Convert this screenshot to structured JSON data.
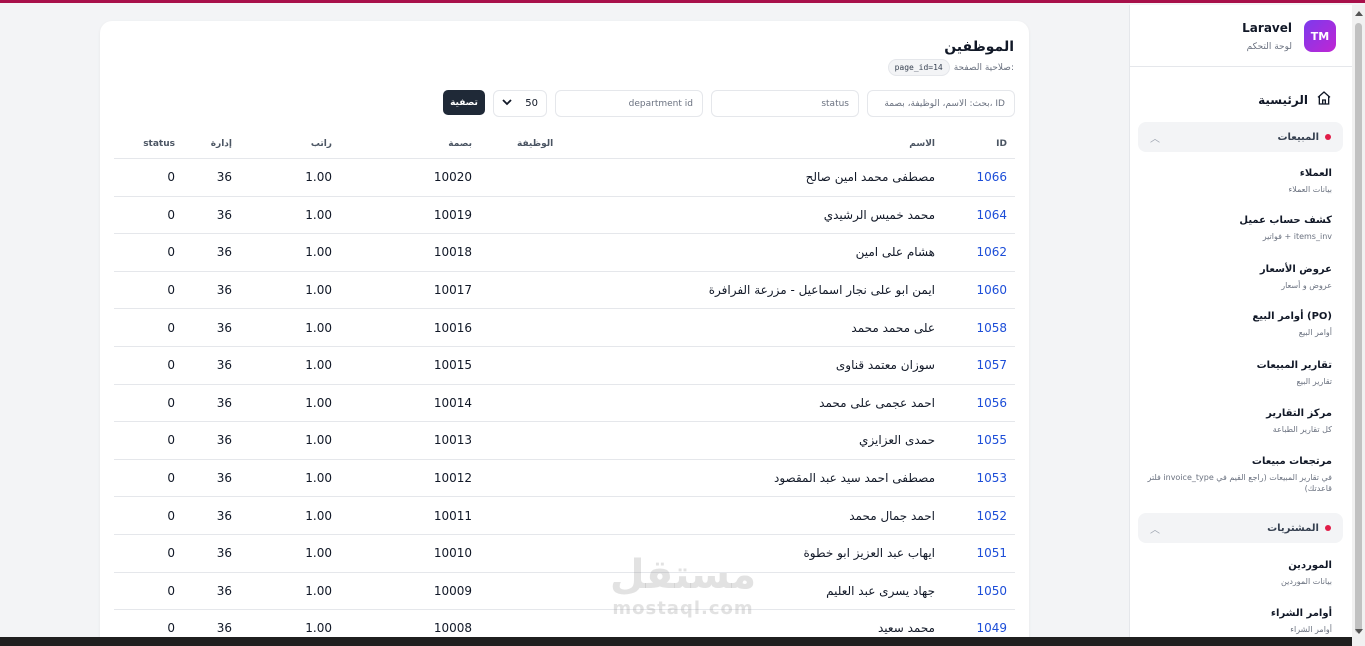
{
  "sidebar": {
    "brand": {
      "logo_text": "TM",
      "name": "Laravel",
      "subtitle": "لوحة التحكم"
    },
    "home_label": "الرئيسية",
    "groups": [
      {
        "label": "المبيعات",
        "items": [
          {
            "title": "العملاء",
            "subtitle": "بيانات العملاء"
          },
          {
            "title": "كشف حساب عميل",
            "subtitle": "فواتير + items_inv"
          },
          {
            "title": "عروض الأسعار",
            "subtitle": "عروض و أسعار"
          },
          {
            "title": "أوامر البيع (PO)",
            "subtitle": "أوامر البيع"
          },
          {
            "title": "تقارير المبيعات",
            "subtitle": "تقارير البيع"
          },
          {
            "title": "مركز التقارير",
            "subtitle": "كل تقارير الطباعة"
          },
          {
            "title": "مرتجعات مبيعات",
            "subtitle": "فلتر invoice_type في تقارير المبيعات (راجع القيم في قاعدتك)"
          }
        ]
      },
      {
        "label": "المشتريات",
        "items": [
          {
            "title": "الموردين",
            "subtitle": "بيانات الموردين"
          },
          {
            "title": "أوامر الشراء",
            "subtitle": "أوامر الشراء"
          }
        ]
      }
    ]
  },
  "main": {
    "title": "الموظفين",
    "permission_label": "صلاحية الصفحة:",
    "permission_value": "page_id=14",
    "filters": {
      "search_placeholder": "بحث: الاسم، الوظيفة، بصمة، ID",
      "status_placeholder": "status",
      "department_placeholder": "department id",
      "per_page": "50",
      "filter_button": "تصفية"
    },
    "columns": [
      "ID",
      "الاسم",
      "الوظيفة",
      "بصمة",
      "راتب",
      "إدارة",
      "status"
    ],
    "rows": [
      {
        "id": "1066",
        "name": "مصطفى محمد امين صالح",
        "job": "",
        "fingerprint": "10020",
        "salary": "1.00",
        "dept": "36",
        "status": "0"
      },
      {
        "id": "1064",
        "name": "محمد خميس الرشيدي",
        "job": "",
        "fingerprint": "10019",
        "salary": "1.00",
        "dept": "36",
        "status": "0"
      },
      {
        "id": "1062",
        "name": "هشام على امين",
        "job": "",
        "fingerprint": "10018",
        "salary": "1.00",
        "dept": "36",
        "status": "0"
      },
      {
        "id": "1060",
        "name": "ايمن ابو على نجار اسماعيل - مزرعة الفرافرة",
        "job": "",
        "fingerprint": "10017",
        "salary": "1.00",
        "dept": "36",
        "status": "0"
      },
      {
        "id": "1058",
        "name": "على محمد محمد",
        "job": "",
        "fingerprint": "10016",
        "salary": "1.00",
        "dept": "36",
        "status": "0"
      },
      {
        "id": "1057",
        "name": "سوزان معتمد قناوى",
        "job": "",
        "fingerprint": "10015",
        "salary": "1.00",
        "dept": "36",
        "status": "0"
      },
      {
        "id": "1056",
        "name": "احمد عجمى على محمد",
        "job": "",
        "fingerprint": "10014",
        "salary": "1.00",
        "dept": "36",
        "status": "0"
      },
      {
        "id": "1055",
        "name": "حمدى العزايزي",
        "job": "",
        "fingerprint": "10013",
        "salary": "1.00",
        "dept": "36",
        "status": "0"
      },
      {
        "id": "1053",
        "name": "مصطفى احمد سيد عبد المقصود",
        "job": "",
        "fingerprint": "10012",
        "salary": "1.00",
        "dept": "36",
        "status": "0"
      },
      {
        "id": "1052",
        "name": "احمد جمال محمد",
        "job": "",
        "fingerprint": "10011",
        "salary": "1.00",
        "dept": "36",
        "status": "0"
      },
      {
        "id": "1051",
        "name": "ايهاب عبد العزيز ابو خطوة",
        "job": "",
        "fingerprint": "10010",
        "salary": "1.00",
        "dept": "36",
        "status": "0"
      },
      {
        "id": "1050",
        "name": "جهاد يسرى عبد العليم",
        "job": "",
        "fingerprint": "10009",
        "salary": "1.00",
        "dept": "36",
        "status": "0"
      },
      {
        "id": "1049",
        "name": "محمد سعيد",
        "job": "",
        "fingerprint": "10008",
        "salary": "1.00",
        "dept": "36",
        "status": "0"
      }
    ]
  },
  "watermark": {
    "arabic": "مستقل",
    "latin": "mostaql.com"
  }
}
